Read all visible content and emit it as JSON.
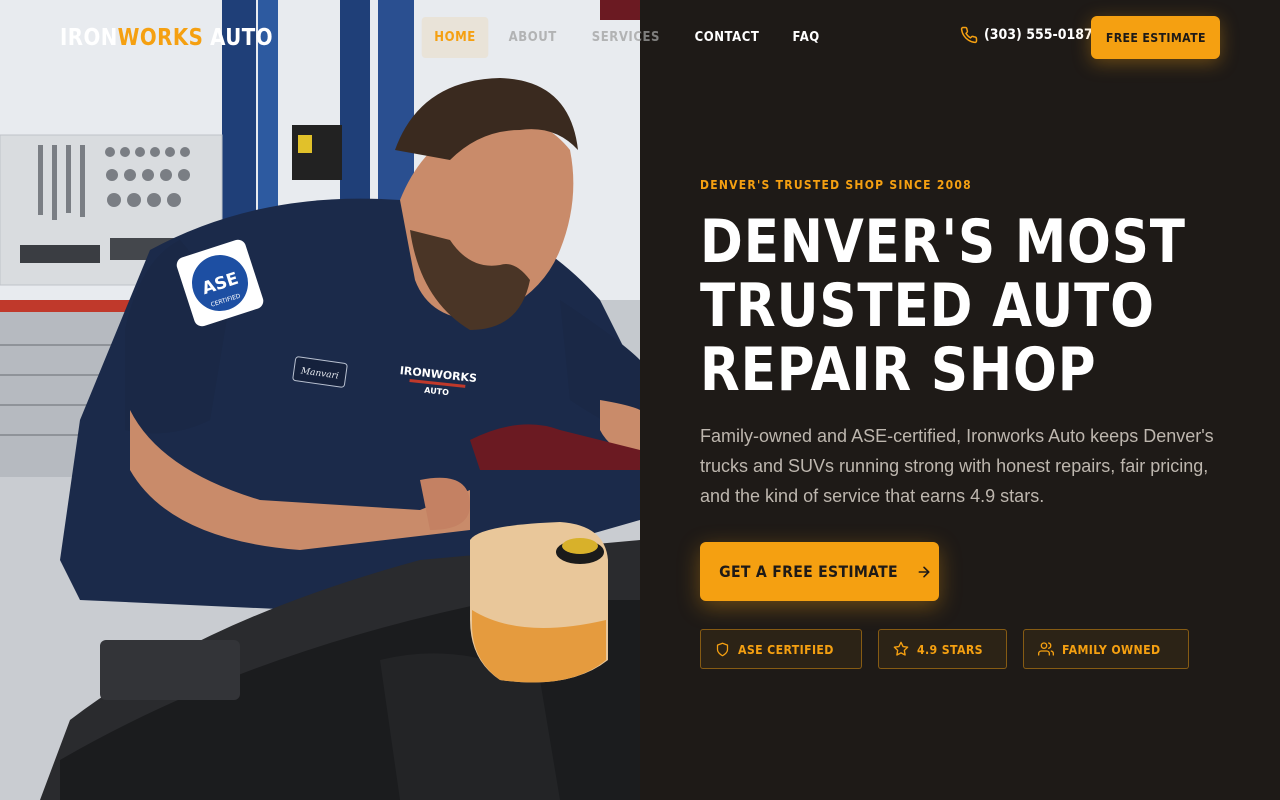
{
  "brand": {
    "logo_part1": "IRON",
    "logo_part2": "WORKS",
    "logo_part3": "AUTO"
  },
  "nav": {
    "items": [
      {
        "label": "HOME",
        "active": true
      },
      {
        "label": "ABOUT"
      },
      {
        "label": "SERVICES"
      },
      {
        "label": "CONTACT"
      },
      {
        "label": "FAQ"
      }
    ]
  },
  "header": {
    "phone": "(303) 555-0187",
    "phone_icon": "phone-icon",
    "cta_label": "FREE ESTIMATE"
  },
  "hero": {
    "eyebrow": "DENVER'S TRUSTED SHOP SINCE 2008",
    "headline_lines": [
      "DENVER'S MOST",
      "TRUSTED AUTO",
      "REPAIR SHOP"
    ],
    "lede": "Family-owned and ASE-certified, Ironworks Auto keeps Denver's trucks and SUVs running strong with honest repairs, fair pricing, and the kind of service that earns 4.9 stars.",
    "cta_label": "GET A FREE ESTIMATE",
    "cta_icon": "arrow-right-icon",
    "badges": [
      {
        "label": "ASE CERTIFIED",
        "icon": "shield-icon"
      },
      {
        "label": "4.9 STARS",
        "icon": "star-icon"
      },
      {
        "label": "FAMILY OWNED",
        "icon": "users-icon"
      }
    ]
  },
  "photo": {
    "patch_text": "ASE",
    "patch_subtext": "CERTIFIED",
    "name_tag": "Manvari",
    "chest_logo_line1": "IRONWORKS",
    "chest_logo_line2": "AUTO"
  },
  "colors": {
    "accent": "#f5a011",
    "panel_bg": "#1e1a17",
    "text_light": "#ffffff",
    "text_muted": "#bdb6ae"
  }
}
